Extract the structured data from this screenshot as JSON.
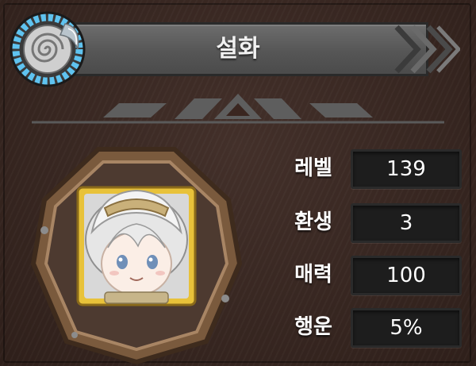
{
  "header": {
    "title": "설화",
    "emblem_icon": "spiral-water-emblem-icon"
  },
  "portrait": {
    "icon": "character-portrait-white-hair-icon"
  },
  "stats": [
    {
      "label": "레벨",
      "value": "139"
    },
    {
      "label": "환생",
      "value": "3"
    },
    {
      "label": "매력",
      "value": "100"
    },
    {
      "label": "행운",
      "value": "5%"
    }
  ],
  "colors": {
    "background": "#3a2620",
    "banner": "#5f5f5f",
    "emblem_ring": "#4fb3e6",
    "stat_box": "#1d1d1d",
    "portrait_frame": "#8a6a4a",
    "portrait_border_gold": "#e8c23a"
  }
}
